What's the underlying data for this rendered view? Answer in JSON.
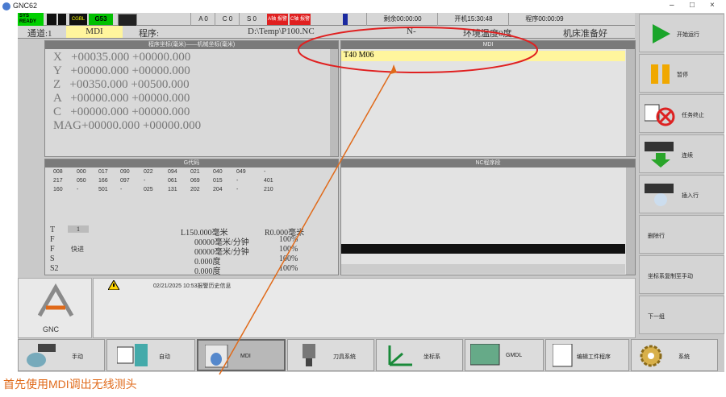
{
  "window": {
    "title": "GNC62",
    "controls": [
      "–",
      "□",
      "×"
    ]
  },
  "status": {
    "sys": "SYS READY",
    "tiles": [
      "CGBL",
      "G53"
    ],
    "axes": [
      "A 0",
      "C 0",
      "S 0"
    ],
    "alarm1": "A轴 报警",
    "alarm2": "C轴 报警",
    "remaining": "剩余00:00:00",
    "power_on": "开机15:30:48",
    "program_time": "程序00:00:09"
  },
  "row2": {
    "channel": "通道:1",
    "mode": "MDI",
    "program_label": "程序:",
    "program_path": "D:\\Temp\\P100.NC",
    "n": "N-",
    "temp": "环境温度0度",
    "machine": "机床准备好"
  },
  "coords": {
    "header": "程序坐标(毫米)——机械坐标(毫米)",
    "rows": [
      "X   +00035.000 +00000.000",
      "Y   +00000.000 +00000.000",
      "Z   +00350.000 +00500.000",
      "A   +00000.000 +00000.000",
      "C   +00000.000 +00000.000",
      "MAG+00000.000 +00000.000"
    ]
  },
  "mdi": {
    "header": "MDI",
    "line": "T40 M06"
  },
  "gcode": {
    "header": "G代码",
    "rows": [
      [
        "008",
        "000",
        "017",
        "090",
        "022",
        "094",
        "021",
        "040",
        "049",
        "-"
      ],
      [
        "217",
        "050",
        "166",
        "097",
        "-",
        "061",
        "069",
        "015",
        "-",
        "401"
      ],
      [
        "160",
        "-",
        "501",
        "-",
        "025",
        "131",
        "202",
        "204",
        "-",
        "210"
      ]
    ]
  },
  "nc": {
    "header": "NC程序段"
  },
  "params": {
    "t_label": "T",
    "t_value": "1",
    "f1": "F",
    "f2": "F",
    "f2_text": "快进",
    "s": "S",
    "s2": "S2",
    "l": "L150.000毫米",
    "r": "R0.000毫米",
    "rows": [
      [
        "00000毫米/分钟",
        "100%"
      ],
      [
        "00000毫米/分钟",
        "100%"
      ],
      [
        "0.000度",
        "100%"
      ],
      [
        "0.000度",
        "100%"
      ]
    ]
  },
  "alarm": {
    "text": "02/21/2025 10:53报警历史信息"
  },
  "logo": {
    "text": "GNC"
  },
  "right_buttons": [
    "开始运行",
    "暂停",
    "任务终止",
    "连续",
    "插入行",
    "删除行",
    "坐标系复制至手动",
    "下一组"
  ],
  "bottom_buttons": [
    "手动",
    "自动",
    "MDI",
    "刀具系统",
    "坐标系",
    "GMDL",
    "编辑工件程序",
    "系统"
  ],
  "caption": "首先使用MDI调出无线测头",
  "colors": {
    "accent_annotation": "#e06a1a",
    "mdi_highlight": "#fff59d",
    "ready_green": "#00d000",
    "alarm_red": "#e02020"
  }
}
